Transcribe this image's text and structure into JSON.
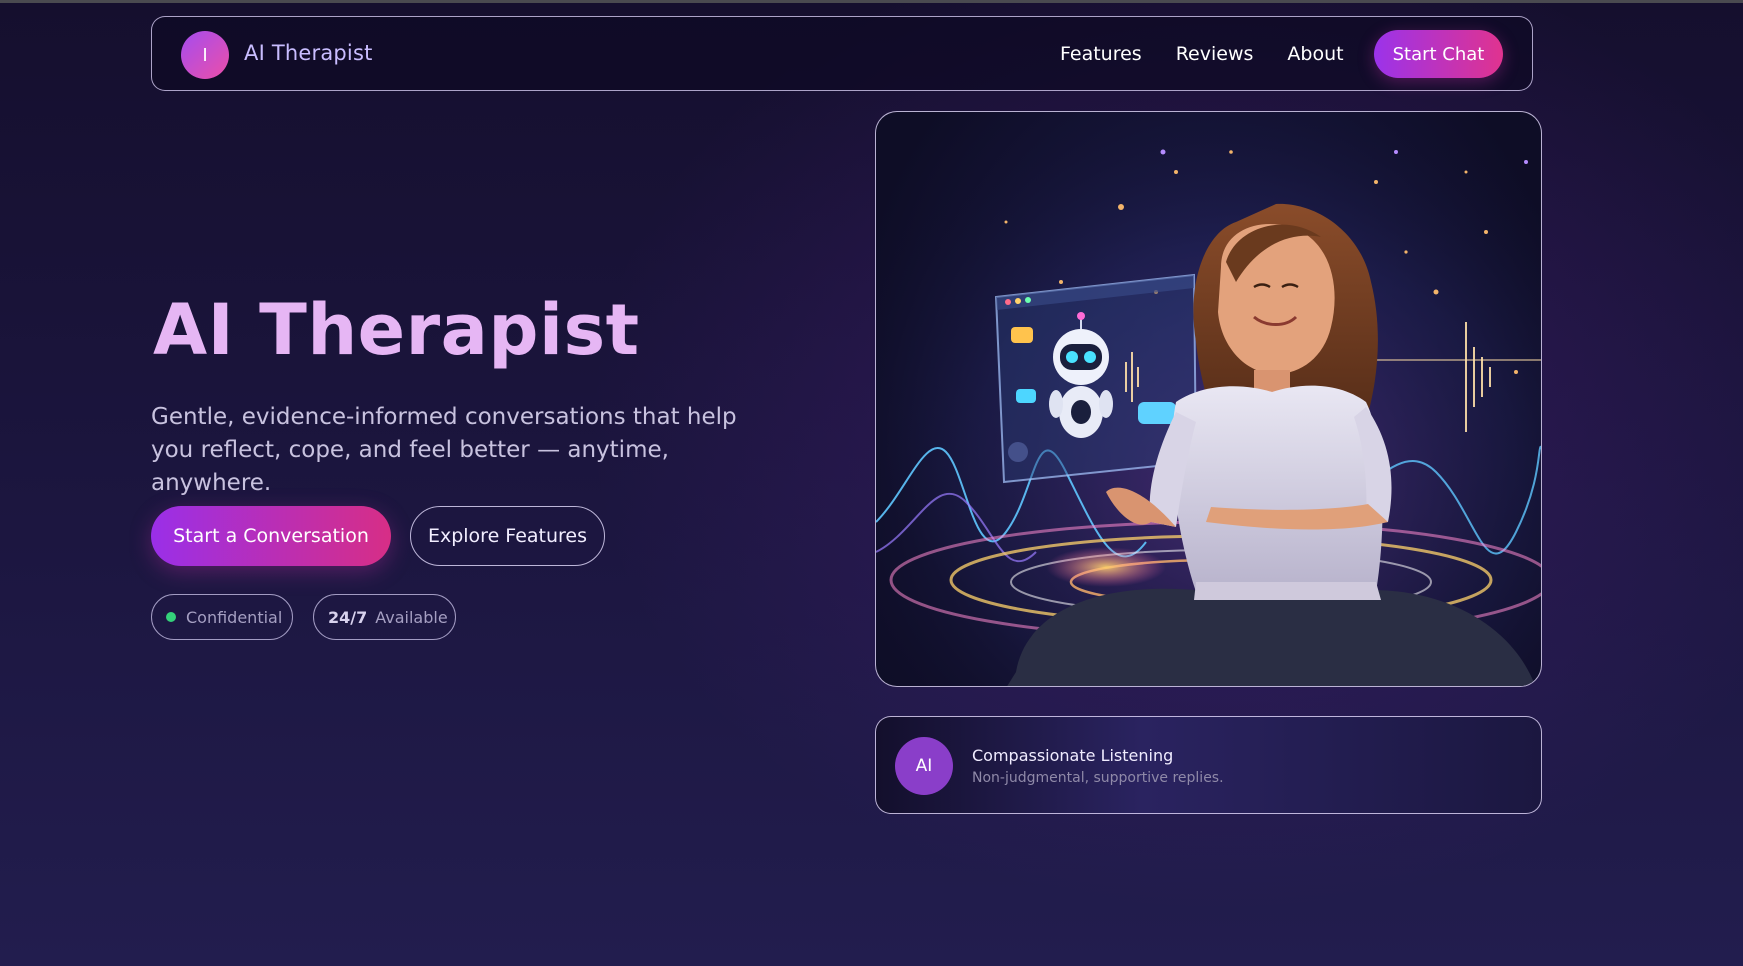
{
  "nav": {
    "brand_initial": "I",
    "brand_name": "AI Therapist",
    "links": [
      {
        "label": "Features"
      },
      {
        "label": "Reviews"
      },
      {
        "label": "About"
      }
    ],
    "cta_label": "Start Chat"
  },
  "hero": {
    "title": "AI Therapist",
    "subtitle": "Gentle, evidence-informed conversations that help you reflect, cope, and feel better — anytime, anywhere.",
    "primary_button": "Start a Conversation",
    "secondary_button": "Explore Features",
    "badges": {
      "confidential": "Confidential",
      "availability_strong": "24/7",
      "availability_label": "Available"
    },
    "image_alt": "Woman smiling while interacting with a friendly AI robot chat assistant"
  },
  "info_card": {
    "avatar_label": "AI",
    "title": "Compassionate Listening",
    "subtitle": "Non-judgmental, supportive replies."
  },
  "colors": {
    "accent_purple": "#9b33ea",
    "accent_pink": "#e0338f",
    "status_green": "#34d17a",
    "title_lilac": "#e6b6f4"
  }
}
